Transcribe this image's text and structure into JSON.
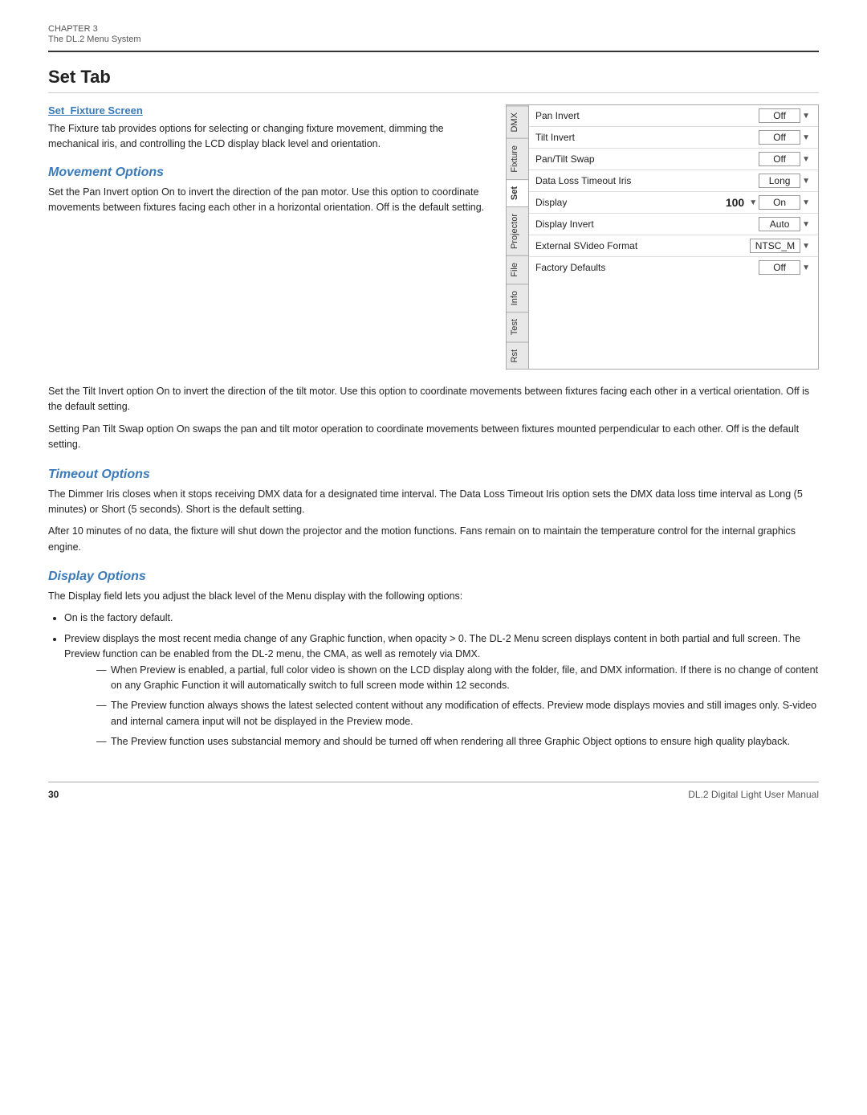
{
  "chapter": {
    "number": "CHAPTER 3",
    "subtitle": "The DL.2 Menu System"
  },
  "set_tab": {
    "title": "Set Tab",
    "subsection": "Set_Fixture Screen",
    "intro_text": "The Fixture tab provides options for selecting or changing fixture movement, dimming the mechanical iris, and controlling the LCD display black level and orientation."
  },
  "tabs": [
    {
      "label": "DMX",
      "active": false
    },
    {
      "label": "Fixture",
      "active": false
    },
    {
      "label": "Set",
      "active": true
    },
    {
      "label": "Projector",
      "active": false
    },
    {
      "label": "File",
      "active": false
    },
    {
      "label": "Info",
      "active": false
    },
    {
      "label": "Test",
      "active": false
    },
    {
      "label": "Rst",
      "active": false
    }
  ],
  "menu_rows": [
    {
      "label": "Pan Invert",
      "value": "Off",
      "highlight": false
    },
    {
      "label": "Tilt Invert",
      "value": "Off",
      "highlight": false
    },
    {
      "label": "Pan/Tilt Swap",
      "value": "Off",
      "highlight": false
    },
    {
      "label": "Data Loss Timeout Iris",
      "value": "Long",
      "highlight": false
    },
    {
      "label": "Display",
      "value": "On",
      "number": "100",
      "highlight": true
    },
    {
      "label": "Display Invert",
      "value": "Auto",
      "highlight": false
    },
    {
      "label": "External SVideo Format",
      "value": "NTSC_M",
      "highlight": false
    },
    {
      "label": "Factory Defaults",
      "value": "Off",
      "highlight": false
    }
  ],
  "movement_options": {
    "title": "Movement Options",
    "text1": "Set the Pan Invert option On to invert the direction of the pan motor. Use this option to coordinate movements between fixtures facing each other in a horizontal orientation. Off is the default setting.",
    "text2": "Set the Tilt Invert option On to invert the direction of the tilt motor. Use this option to coordinate movements between fixtures facing each other in a vertical orientation. Off is the default setting.",
    "text3": "Setting Pan Tilt Swap option On swaps the pan and tilt motor operation to coordinate movements between fixtures mounted perpendicular to each other. Off is the default setting."
  },
  "timeout_options": {
    "title": "Timeout Options",
    "text1": "The Dimmer Iris closes when it stops receiving DMX data for a designated time interval. The Data Loss Timeout Iris option sets the DMX data loss time interval as Long (5 minutes) or Short (5 seconds). Short is the default setting.",
    "text2": "After 10 minutes of no data, the fixture will shut down the projector and the motion functions. Fans remain on to maintain the temperature control for the internal graphics engine."
  },
  "display_options": {
    "title": "Display Options",
    "intro": "The Display field lets you adjust the black level of the Menu display with the following options:",
    "bullets": [
      {
        "text": "On is the factory default.",
        "dashes": []
      },
      {
        "text": "Preview displays the most recent media change of any Graphic function, when opacity > 0. The DL-2 Menu screen displays content in both partial and full screen. The Preview function can be enabled from the DL-2 menu, the CMA, as well as remotely via DMX.",
        "dashes": [
          "When Preview is enabled, a partial, full color video is shown on the LCD display along with the folder, file, and DMX information. If there is no change of content on any Graphic Function it will automatically switch to full screen mode within 12 seconds.",
          "The Preview function always shows the latest selected content without any modification of effects. Preview mode displays movies and still images only. S-video and internal camera input will not be displayed in the Preview mode.",
          "The Preview function uses substancial memory and should be turned off when rendering all three Graphic Object options to ensure high quality playback."
        ]
      }
    ]
  },
  "footer": {
    "page_number": "30",
    "manual_title": "DL.2 Digital Light User Manual"
  }
}
